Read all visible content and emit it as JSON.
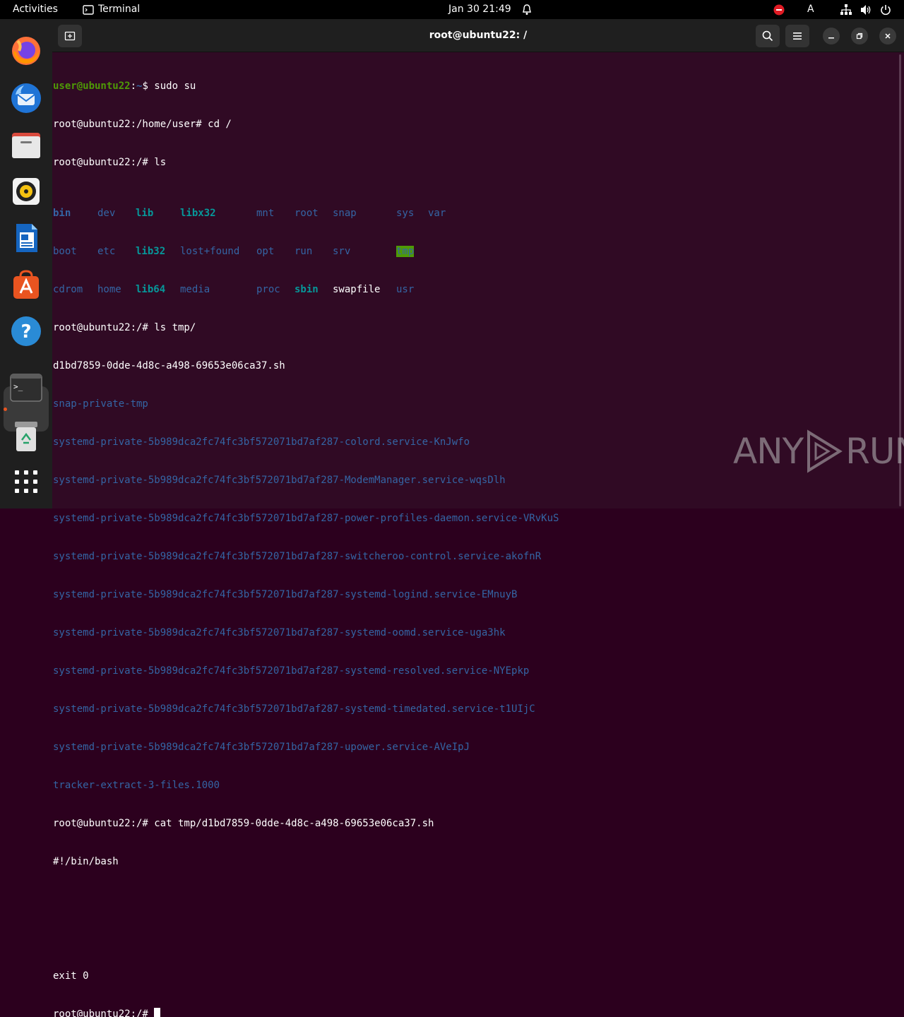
{
  "topbar": {
    "activities": "Activities",
    "app_name": "Terminal",
    "clock": "Jan 30  21:49",
    "lang": "A"
  },
  "window": {
    "title": "root@ubuntu22: /"
  },
  "dock": {
    "items": [
      "firefox",
      "thunderbird",
      "files",
      "rhythmbox",
      "libreoffice-writer",
      "software-center",
      "help",
      "terminal",
      "trash",
      "app-grid"
    ]
  },
  "terminal": {
    "l1_user": "user@ubuntu22",
    "l1_sep": ":",
    "l1_path": "~",
    "l1_cmd": "$ sudo su",
    "l2": "root@ubuntu22:/home/user# cd /",
    "l3": "root@ubuntu22:/# ls",
    "ls": [
      [
        "bin",
        "dev",
        "lib",
        "libx32",
        "mnt",
        "root",
        "snap",
        "sys",
        "var"
      ],
      [
        "boot",
        "etc",
        "lib32",
        "lost+found",
        "opt",
        "run",
        "srv",
        "tmp"
      ],
      [
        "cdrom",
        "home",
        "lib64",
        "media",
        "proc",
        "sbin",
        "swapfile",
        "usr"
      ]
    ],
    "l7": "root@ubuntu22:/# ls tmp/",
    "tmp_list": [
      "d1bd7859-0dde-4d8c-a498-69653e06ca37.sh",
      "snap-private-tmp",
      "systemd-private-5b989dca2fc74fc3bf572071bd7af287-colord.service-KnJwfo",
      "systemd-private-5b989dca2fc74fc3bf572071bd7af287-ModemManager.service-wqsDlh",
      "systemd-private-5b989dca2fc74fc3bf572071bd7af287-power-profiles-daemon.service-VRvKuS",
      "systemd-private-5b989dca2fc74fc3bf572071bd7af287-switcheroo-control.service-akofnR",
      "systemd-private-5b989dca2fc74fc3bf572071bd7af287-systemd-logind.service-EMnuyB",
      "systemd-private-5b989dca2fc74fc3bf572071bd7af287-systemd-oomd.service-uga3hk",
      "systemd-private-5b989dca2fc74fc3bf572071bd7af287-systemd-resolved.service-NYEpkp",
      "systemd-private-5b989dca2fc74fc3bf572071bd7af287-systemd-timedated.service-t1UIjC",
      "systemd-private-5b989dca2fc74fc3bf572071bd7af287-upower.service-AVeIpJ",
      "tracker-extract-3-files.1000"
    ],
    "cat_cmd": "root@ubuntu22:/# cat tmp/d1bd7859-0dde-4d8c-a498-69653e06ca37.sh",
    "cat_out1": "#!/bin/bash",
    "cat_out2": "exit 0",
    "prompt": "root@ubuntu22:/# "
  },
  "watermark": {
    "left": "ANY",
    "right": "RUN"
  }
}
